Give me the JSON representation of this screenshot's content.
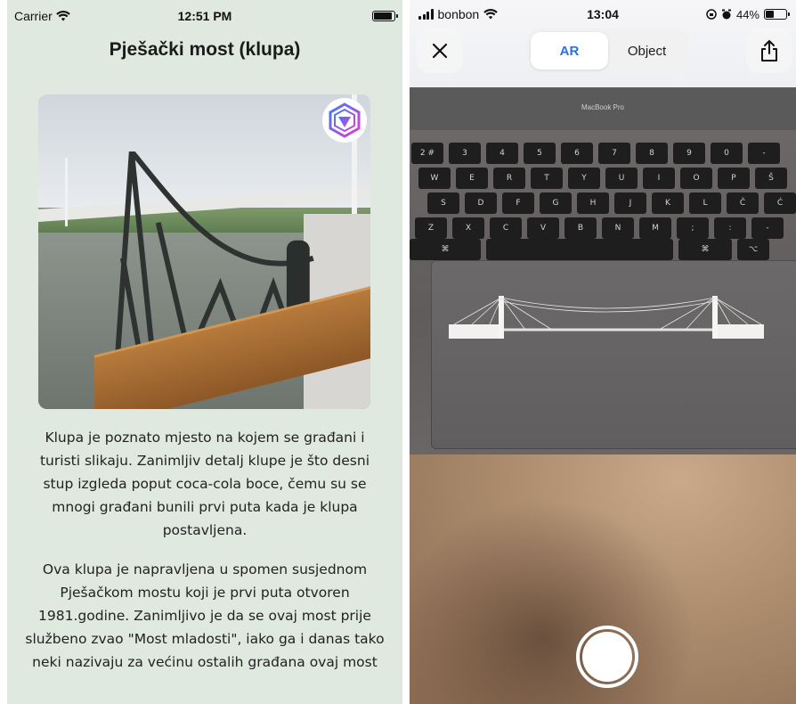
{
  "left": {
    "status": {
      "carrier": "Carrier",
      "time": "12:51 PM",
      "battery_level": 0.9
    },
    "title": "Pješački most (klupa)",
    "photo": {
      "subject": "bench-by-pedestrian-bridge",
      "badge_icon": "ar-logo-icon"
    },
    "paragraphs": [
      "Klupa je poznato mjesto na kojem se građani i turisti slikaju. Zanimljiv detalj klupe je što desni stup izgleda poput coca-cola boce, čemu su se mnogi građani bunili prvi puta kada je klupa postavljena.",
      "Ova klupa je napravljena u spomen susjednom Pješačkom mostu koji je prvi puta otvoren 1981.godine. Zanimljivo je da se ovaj most prije službeno zvao \"Most mladosti\", iako ga i danas tako neki nazivaju za većinu ostalih građana ovaj most"
    ],
    "colors": {
      "background": "#dfe9df"
    }
  },
  "right": {
    "status": {
      "carrier": "bonbon",
      "time": "13:04",
      "battery_text": "44%",
      "battery_level": 0.44
    },
    "toolbar": {
      "close_icon": "close-icon",
      "tabs": [
        {
          "label": "AR",
          "active": true
        },
        {
          "label": "Object",
          "active": false
        }
      ],
      "share_icon": "share-icon"
    },
    "scene": {
      "laptop_label": "MacBook Pro"
    },
    "shutter_icon": "shutter-button",
    "colors": {
      "accent": "#2d72d9"
    }
  }
}
